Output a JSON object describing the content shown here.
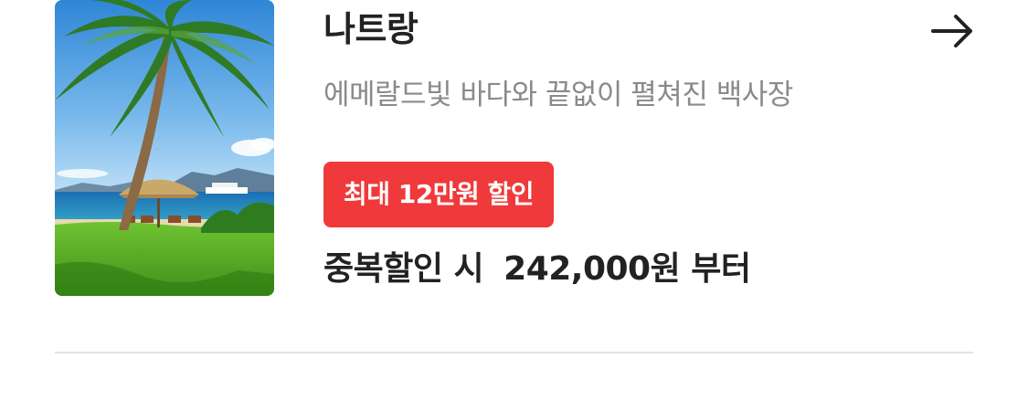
{
  "product": {
    "title": "나트랑",
    "subtitle": "에메랄드빛 바다와 끝없이 펼쳐진 백사장",
    "discount_badge": "최대 12만원 할인",
    "price_prefix": "중복할인 시",
    "price_amount": "242,000원",
    "price_suffix": "부터",
    "arrow_icon": "arrow-right-icon",
    "image_icon": "beach-palm-photo"
  },
  "colors": {
    "badge_bg": "#f0393a",
    "title_text": "#222222",
    "subtitle_text": "#8a8a8a",
    "divider": "#e2e2e2"
  }
}
